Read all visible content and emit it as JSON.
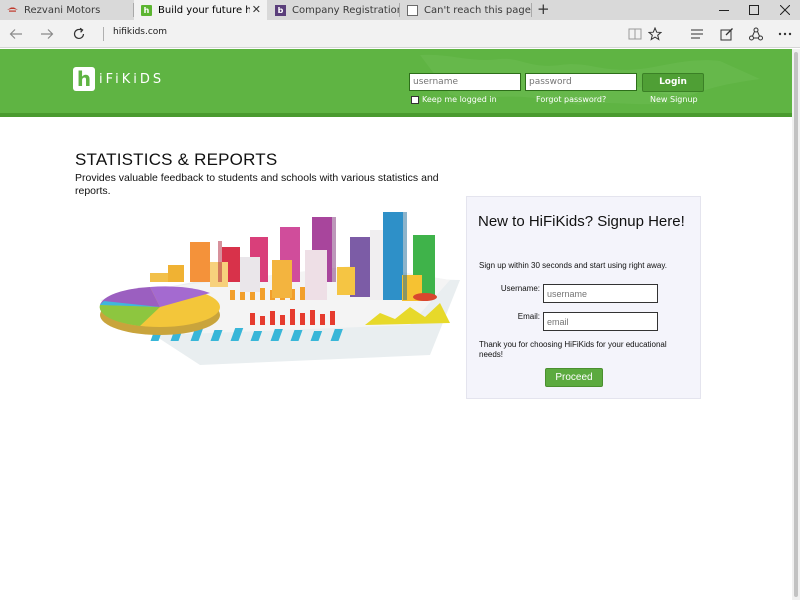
{
  "browser": {
    "tabs": [
      {
        "title": "Rezvani Motors",
        "favicon": "rezvani-logo-icon",
        "active": false
      },
      {
        "title": "Build your future here...",
        "favicon": "hifikids-icon",
        "active": true
      },
      {
        "title": "Company Registration with",
        "favicon": "company-icon",
        "active": false
      },
      {
        "title": "Can't reach this page",
        "favicon": "page-icon",
        "active": false
      }
    ],
    "new_tab": "+",
    "address": "hifikids.com"
  },
  "header": {
    "logo_letter": "h",
    "logo_text": "iFiKiDS",
    "username_placeholder": "username",
    "password_placeholder": "password",
    "login_label": "Login",
    "keep_logged_in": "Keep me logged in",
    "forgot_password": "Forgot password?",
    "new_signup": "New Signup",
    "brand_color": "#5fb443"
  },
  "main": {
    "title": "STATISTICS & REPORTS",
    "description": "Provides valuable feedback to students and schools with various statistics and reports."
  },
  "signup": {
    "title": "New to HiFiKids? Signup Here!",
    "subtitle": "Sign up within 30 seconds and start using right away.",
    "username_label": "Username:",
    "username_placeholder": "username",
    "email_label": "Email:",
    "email_placeholder": "email",
    "thanks": "Thank you for choosing HiFiKids for your educational needs!",
    "proceed_label": "Proceed"
  }
}
